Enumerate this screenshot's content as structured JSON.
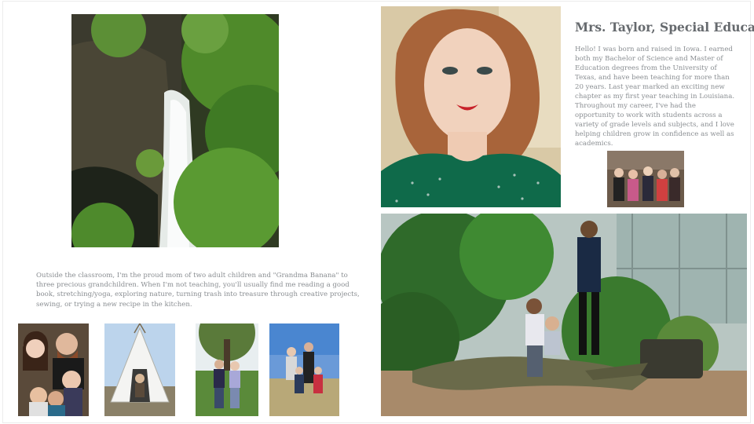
{
  "profile": {
    "title": "Mrs. Taylor, Special Education",
    "bio": "Hello! I was born and raised in Iowa. I earned both my Bachelor of Science and Master of Education degrees from the University of Texas, and have been teaching for more than 20 years. Last year marked an exciting new chapter as my first year teaching in Louisiana. Throughout my career, I've had the opportunity to work with students across a variety of grade levels and subjects, and I love helping children grow in confidence as well as academics."
  },
  "personal": {
    "text": "Outside the classroom, I'm the proud mom of two adult children and \"Grandma Banana\" to three precious grandchildren. When I'm not teaching, you'll usually find me reading a good book, stretching/yoga, exploring nature, turning trash into treasure through creative projects, sewing, or trying a new recipe in the kitchen."
  },
  "colors": {
    "text_title": "#666a6e",
    "text_body": "#8a8e92",
    "page_bg": "#ffffff"
  }
}
